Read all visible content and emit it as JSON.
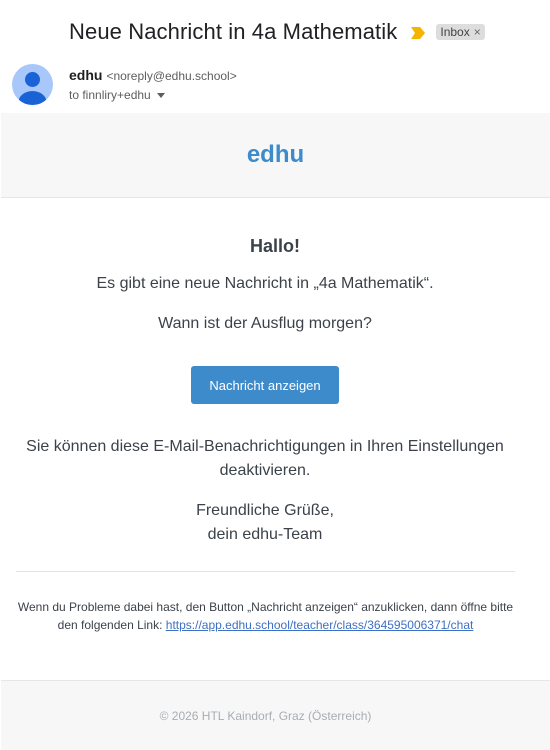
{
  "header": {
    "subject": "Neue Nachricht in 4a Mathematik",
    "label": "Inbox",
    "label_remove": "×",
    "important_color": "#f4b400"
  },
  "sender": {
    "name": "edhu",
    "email": "<noreply@edhu.school>",
    "to": "to finnliry+edhu"
  },
  "email": {
    "brand": "edhu",
    "greeting": "Hallo!",
    "intro": "Es gibt eine neue Nachricht in „4a Mathematik“.",
    "message": "Wann ist der Ausflug morgen?",
    "button_label": "Nachricht anzeigen",
    "note": "Sie können diese E-Mail-Benachrichtigungen in Ihren Einstellungen deaktivieren.",
    "signoff_1": "Freundliche Grüße,",
    "signoff_2": "dein edhu-Team",
    "help_text": "Wenn du Probleme dabei hast, den Button „Nachricht anzeigen“ anzuklicken, dann öffne bitte den folgenden Link: ",
    "help_link": "https://app.edhu.school/teacher/class/364595006371/chat",
    "footer": "© 2026 HTL Kaindorf, Graz (Österreich)"
  },
  "colors": {
    "accent": "#3d8bcb",
    "avatar_bg": "#a8c7fa",
    "avatar_fg": "#1a63d6"
  },
  "icons": {
    "important": "important-marker-icon",
    "avatar": "default-person-avatar-icon",
    "caret": "caret-down-icon"
  }
}
